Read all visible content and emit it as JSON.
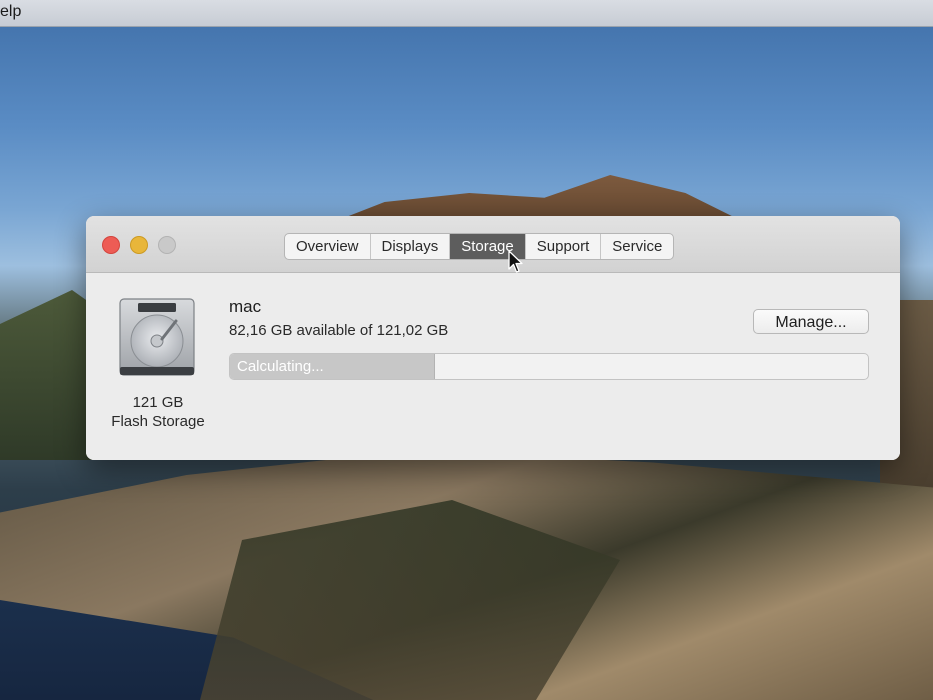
{
  "menubar": {
    "partial_item": "elp"
  },
  "window": {
    "tabs": [
      {
        "label": "Overview"
      },
      {
        "label": "Displays"
      },
      {
        "label": "Storage"
      },
      {
        "label": "Support"
      },
      {
        "label": "Service"
      }
    ],
    "active_tab": "Storage"
  },
  "storage": {
    "disk": {
      "icon": "hard-drive-icon",
      "size": "121 GB",
      "type": "Flash Storage"
    },
    "volume": {
      "name": "mac",
      "capacity": "82,16 GB available of 121,02 GB"
    },
    "progress": {
      "label": "Calculating...",
      "fill_fraction": 0.32
    },
    "manage_label": "Manage..."
  },
  "colors": {
    "close": "#ed5c55",
    "minimize": "#e8b63a",
    "zoom": "#c9c9c9",
    "active_tab": "#5d5d5d"
  }
}
